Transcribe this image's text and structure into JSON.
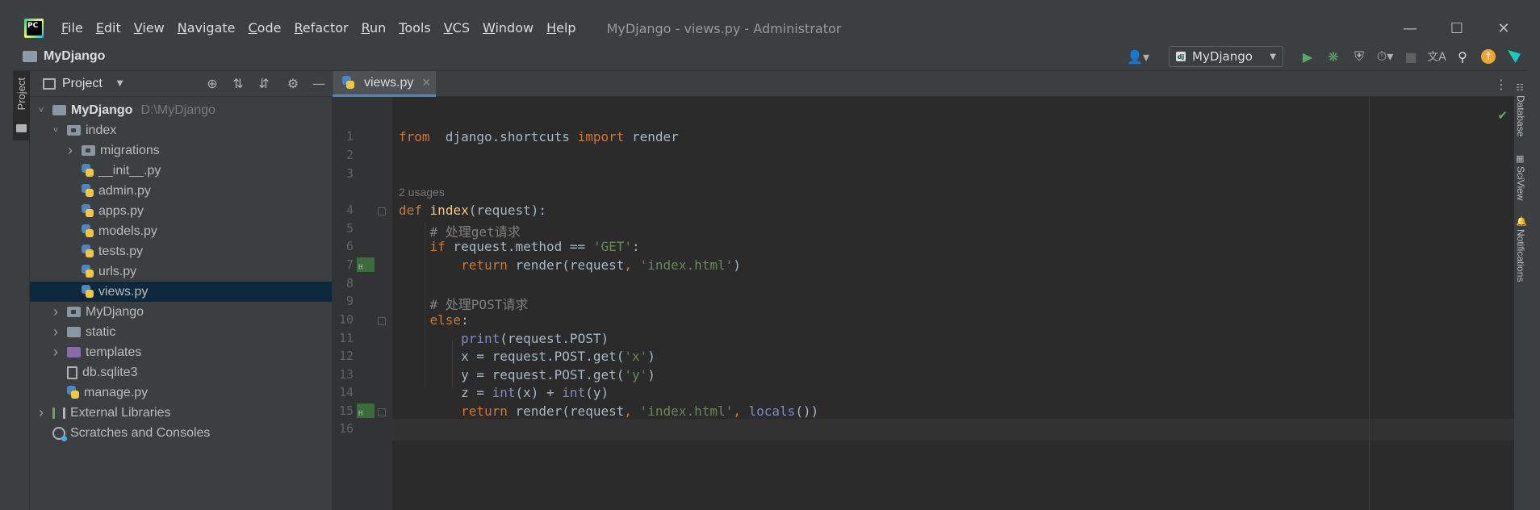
{
  "titlebar": {
    "menu": [
      {
        "label": "File",
        "underline": "F",
        "rest": "ile"
      },
      {
        "label": "Edit",
        "underline": "E",
        "rest": "dit"
      },
      {
        "label": "View",
        "underline": "V",
        "rest": "iew"
      },
      {
        "label": "Navigate",
        "underline": "N",
        "rest": "avigate"
      },
      {
        "label": "Code",
        "underline": "C",
        "rest": "ode"
      },
      {
        "label": "Refactor",
        "underline": "R",
        "rest": "efactor"
      },
      {
        "label": "Run",
        "underline": "R",
        "rest": "un"
      },
      {
        "label": "Tools",
        "underline": "T",
        "rest": "ools"
      },
      {
        "label": "VCS",
        "underline": "V",
        "rest": "CS"
      },
      {
        "label": "Window",
        "underline": "W",
        "rest": "indow"
      },
      {
        "label": "Help",
        "underline": "H",
        "rest": "elp"
      }
    ],
    "window_title": "MyDjango - views.py - Administrator"
  },
  "navbar": {
    "project_name": "MyDjango",
    "run_config": "MyDjango"
  },
  "left_strip": {
    "project_tab": "Project"
  },
  "project_panel": {
    "title": "Project",
    "tree": [
      {
        "label": "MyDjango",
        "path": "D:\\MyDjango",
        "type": "folder",
        "level": 0,
        "expanded": true,
        "bold": true
      },
      {
        "label": "index",
        "type": "folder-dot",
        "level": 1,
        "expanded": true
      },
      {
        "label": "migrations",
        "type": "folder-dot",
        "level": 2,
        "expanded": false
      },
      {
        "label": "__init__.py",
        "type": "py",
        "level": 2
      },
      {
        "label": "admin.py",
        "type": "py",
        "level": 2
      },
      {
        "label": "apps.py",
        "type": "py",
        "level": 2
      },
      {
        "label": "models.py",
        "type": "py",
        "level": 2
      },
      {
        "label": "tests.py",
        "type": "py",
        "level": 2
      },
      {
        "label": "urls.py",
        "type": "py",
        "level": 2
      },
      {
        "label": "views.py",
        "type": "py",
        "level": 2,
        "selected": true
      },
      {
        "label": "MyDjango",
        "type": "folder-dot",
        "level": 1,
        "expanded": false
      },
      {
        "label": "static",
        "type": "folder",
        "level": 1,
        "expanded": false
      },
      {
        "label": "templates",
        "type": "folder-purple",
        "level": 1,
        "expanded": false
      },
      {
        "label": "db.sqlite3",
        "type": "db",
        "level": 1
      },
      {
        "label": "manage.py",
        "type": "py",
        "level": 1
      },
      {
        "label": "External Libraries",
        "type": "lib",
        "level": 0,
        "expanded": false
      },
      {
        "label": "Scratches and Consoles",
        "type": "scratch",
        "level": 0
      }
    ]
  },
  "editor": {
    "tab_label": "views.py",
    "usages_hint": "2 usages",
    "lines": [
      {
        "n": "1",
        "tokens": [
          [
            "kw",
            "from"
          ],
          [
            "",
            "  django.shortcuts "
          ],
          [
            "kw",
            "import"
          ],
          [
            "",
            " render"
          ]
        ]
      },
      {
        "n": "2",
        "tokens": []
      },
      {
        "n": "3",
        "tokens": []
      },
      {
        "n": "4",
        "tokens": [
          [
            "kw",
            "def"
          ],
          [
            "",
            " "
          ],
          [
            "fn",
            "index"
          ],
          [
            "",
            "(request):"
          ]
        ]
      },
      {
        "n": "5",
        "tokens": [
          [
            "",
            "    "
          ],
          [
            "cm",
            "# 处理get请求"
          ]
        ]
      },
      {
        "n": "6",
        "tokens": [
          [
            "",
            "    "
          ],
          [
            "kw",
            "if"
          ],
          [
            "",
            " request.method == "
          ],
          [
            "str",
            "'GET'"
          ],
          [
            "",
            ":"
          ]
        ]
      },
      {
        "n": "7",
        "tokens": [
          [
            "",
            "        "
          ],
          [
            "kw",
            "return"
          ],
          [
            "",
            " render(request"
          ],
          [
            "kw",
            ","
          ],
          [
            "",
            " "
          ],
          [
            "str",
            "'index.html'"
          ],
          [
            "",
            ")"
          ]
        ]
      },
      {
        "n": "8",
        "tokens": []
      },
      {
        "n": "9",
        "tokens": [
          [
            "",
            "    "
          ],
          [
            "cm",
            "# 处理POST请求"
          ]
        ]
      },
      {
        "n": "10",
        "tokens": [
          [
            "",
            "    "
          ],
          [
            "kw",
            "else"
          ],
          [
            "",
            ":"
          ]
        ]
      },
      {
        "n": "11",
        "tokens": [
          [
            "",
            "        "
          ],
          [
            "bi",
            "print"
          ],
          [
            "",
            "(request.POST)"
          ]
        ]
      },
      {
        "n": "12",
        "tokens": [
          [
            "",
            "        x = request.POST.get("
          ],
          [
            "str",
            "'x'"
          ],
          [
            "",
            ")"
          ]
        ]
      },
      {
        "n": "13",
        "tokens": [
          [
            "",
            "        y = request.POST.get("
          ],
          [
            "str",
            "'y'"
          ],
          [
            "",
            ")"
          ]
        ]
      },
      {
        "n": "14",
        "tokens": [
          [
            "",
            "        z = "
          ],
          [
            "bi",
            "int"
          ],
          [
            "",
            "(x) + "
          ],
          [
            "bi",
            "int"
          ],
          [
            "",
            "(y)"
          ]
        ]
      },
      {
        "n": "15",
        "tokens": [
          [
            "",
            "        "
          ],
          [
            "kw",
            "return"
          ],
          [
            "",
            " render(request"
          ],
          [
            "kw",
            ","
          ],
          [
            "",
            " "
          ],
          [
            "str",
            "'index.html'"
          ],
          [
            "kw",
            ","
          ],
          [
            "",
            " "
          ],
          [
            "bi",
            "locals"
          ],
          [
            "",
            "())"
          ]
        ]
      },
      {
        "n": "16",
        "tokens": []
      }
    ]
  },
  "right_strip": {
    "tabs": [
      "Database",
      "SciView",
      "Notifications"
    ]
  },
  "colors": {
    "keyword": "#cc7832",
    "function": "#ffc66d",
    "string": "#6a8759",
    "comment": "#808080",
    "builtin": "#8888c6",
    "selection": "#0d293e"
  }
}
